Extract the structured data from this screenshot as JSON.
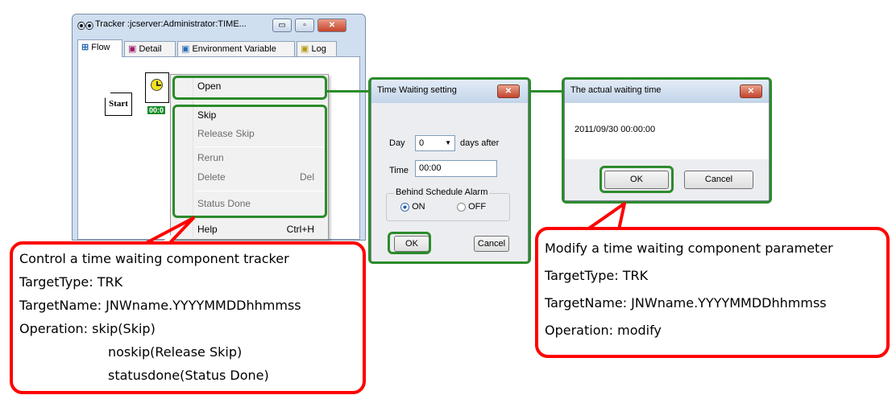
{
  "tracker": {
    "title": "Tracker :jcserver:Administrator:TIME...",
    "minimize_glyph": "▭",
    "maximize_glyph": "▫",
    "close_glyph": "✕",
    "tabs": [
      {
        "label": "Flow",
        "icon": "flow-icon"
      },
      {
        "label": "Detail",
        "icon": "detail-icon"
      },
      {
        "label": "Environment Variable",
        "icon": "env-var-icon"
      },
      {
        "label": "Log",
        "icon": "log-icon"
      }
    ],
    "start_node_label": "Start",
    "timer_node_label": "00:0"
  },
  "context_menu": {
    "items": [
      {
        "label": "Open",
        "shortcut": "",
        "enabled": true
      },
      {
        "label": "Skip",
        "shortcut": "",
        "enabled": true
      },
      {
        "label": "Release Skip",
        "shortcut": "",
        "enabled": false
      },
      {
        "label": "Rerun",
        "shortcut": "",
        "enabled": false
      },
      {
        "label": "Delete",
        "shortcut": "Del",
        "enabled": false
      },
      {
        "label": "Status Done",
        "shortcut": "",
        "enabled": false
      },
      {
        "label": "Help",
        "shortcut": "Ctrl+H",
        "enabled": true
      }
    ]
  },
  "time_waiting_dialog": {
    "title": "Time Waiting setting",
    "close_glyph": "✕",
    "day_label": "Day",
    "day_value": "0",
    "day_suffix": "days after",
    "time_label": "Time",
    "time_value": "00:00",
    "alarm_group_label": "Behind Schedule Alarm",
    "on_label": "ON",
    "off_label": "OFF",
    "selected": "ON",
    "ok_label": "OK",
    "cancel_label": "Cancel"
  },
  "actual_waiting_dialog": {
    "title": "The actual waiting time",
    "close_glyph": "✕",
    "datetime": "2011/09/30  00:00:00",
    "ok_label": "OK",
    "cancel_label": "Cancel"
  },
  "callout_left": {
    "lines": [
      "Control a time waiting component tracker",
      "TargetType: TRK",
      "TargetName: JNWname.YYYYMMDDhhmmss",
      "Operation: skip(Skip)",
      "noskip(Release Skip)",
      "statusdone(Status Done)"
    ]
  },
  "callout_right": {
    "lines": [
      "Modify a time waiting component parameter",
      "TargetType: TRK",
      "TargetName: JNWname.YYYYMMDDhhmmss",
      "Operation: modify"
    ]
  },
  "colors": {
    "highlight": "#2c8b2c",
    "callout_border": "#ff0000",
    "timer_badge": "#148b25"
  }
}
